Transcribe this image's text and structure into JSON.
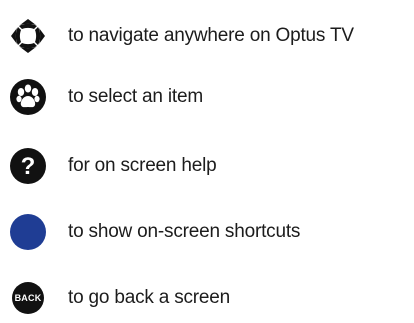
{
  "instructions": [
    {
      "icon": "dpad-navigate-icon",
      "label": "to navigate anywhere on Optus TV"
    },
    {
      "icon": "paw-select-icon",
      "label": "to select an item"
    },
    {
      "icon": "question-help-icon",
      "label": "for on screen help"
    },
    {
      "icon": "blue-button-icon",
      "label": "to show on-screen shortcuts"
    },
    {
      "icon": "back-button-icon",
      "label": "to go back a screen",
      "icon_text": "BACK"
    }
  ],
  "colors": {
    "text": "#1c1c1c",
    "icon_dark": "#111111",
    "blue_button": "#1f3d94"
  }
}
